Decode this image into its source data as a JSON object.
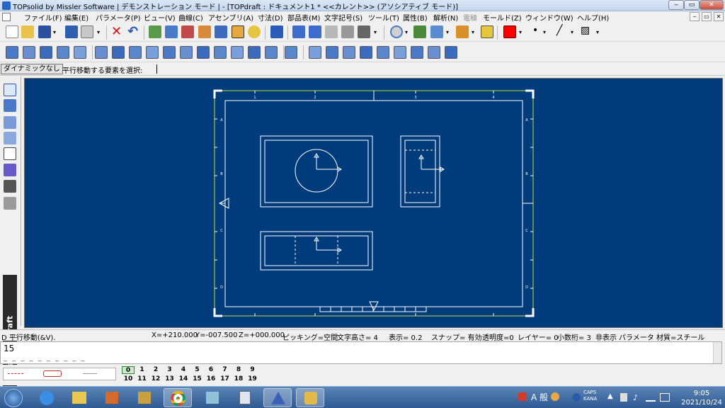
{
  "window": {
    "title": "TOPsolid by Missler Software | デモンストレーション モード | - [TOPdraft : ドキュメント1 *  <<カレント>> (アソシアティブ モード)]",
    "buttons": [
      "‒",
      "▭",
      "✕"
    ]
  },
  "menu": {
    "items": [
      "ファイル(F)",
      "編集(E)",
      "パラメータ(P)",
      "ビュー(V)",
      "曲線(C)",
      "アセンブリ(A)",
      "寸法(D)",
      "部品表(M)",
      "文字記号(S)",
      "ツール(T)",
      "属性(B)",
      "解析(N)",
      "電極",
      "モールド(Z)",
      "ウィンドウ(W)",
      "ヘルプ(H)"
    ],
    "mdi_buttons": [
      "‒",
      "▭",
      "✕"
    ]
  },
  "prompt": {
    "mode_button": "ダイナミックなし",
    "message": "平行移動する要素を選択:"
  },
  "brand": {
    "text": "TOPsolid ' Draft"
  },
  "status": {
    "command": "D 平行移動(&V).",
    "x": "X=+210.000",
    "y": "Y=-007.500",
    "z": "Z=+000.000",
    "picking": "ピッキング=空間",
    "text_height": "文字高さ=  4",
    "display": "表示=   0.2",
    "snap": "スナップ= 有効",
    "transparency": "透明度=0",
    "layer": "レイヤー=  0",
    "decimals": "小数桁= 3",
    "hidden": "非表示",
    "parameter": "パラメータ",
    "material": "材質=スチール"
  },
  "command_input": {
    "value": "15",
    "dashes": "_ _ _ _ _ _ _ _ _ _"
  },
  "pens": {
    "row1": [
      "0",
      "1",
      "2",
      "3",
      "4",
      "5",
      "6",
      "7",
      "8",
      "9"
    ],
    "row2": [
      "10",
      "11",
      "12",
      "13",
      "14",
      "15",
      "16",
      "17",
      "18",
      "19"
    ]
  },
  "drawing_sheet": {
    "top_ticks": [
      "1",
      "2",
      "3",
      "4"
    ],
    "side_ticks": [
      "A",
      "B",
      "C",
      "D"
    ]
  },
  "clock": {
    "time": "9:05",
    "date": "2021/10/24"
  },
  "tray": {
    "ime": "A 般",
    "caps": "CAPS",
    "kana": "KANA"
  },
  "colors": {
    "canvas": "#003b7c",
    "sheet_line": "#ffffff",
    "sheet_corner": "#ffffff",
    "active_color": "#ff0000"
  }
}
